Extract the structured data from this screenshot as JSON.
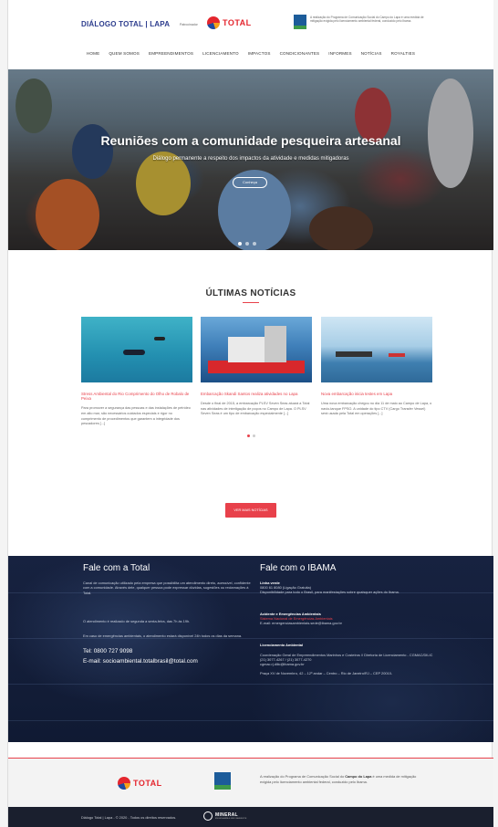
{
  "header": {
    "site_title": "DIÁLOGO TOTAL | LAPA",
    "patrocinio": "Patrocinador",
    "total_logo_text": "TOTAL",
    "ibama_note": "A realização do Programa de Comunicação Social do Campo do Lapa é uma medida de mitigação exigida pelo licenciamento ambiental federal, conduzido pelo Ibama."
  },
  "nav": [
    "HOME",
    "QUEM SOMOS",
    "EMPREENDIMENTOS",
    "LICENCIAMENTO",
    "IMPACTOS",
    "CONDICIONANTES",
    "INFORMES",
    "NOTÍCIAS",
    "ROYALTIES"
  ],
  "hero": {
    "title": "Reuniões com a comunidade pesqueira artesanal",
    "subtitle": "Diálogo permanente a respeito dos impactos da atividade e medidas mitigadoras",
    "button": "Conheça"
  },
  "news": {
    "section_title": "ÚLTIMAS NOTÍCIAS",
    "cards": [
      {
        "title": "Stress Ambiental do Rio Comprimento do Olho de Robalo de Peixa",
        "body": "Para promover a segurança das pessoas e das instalações de petróleo em alto mar, são necessários cuidados especiais e rígor no cumprimento de procedimentos que garantem a integridade dos pescadores [...]"
      },
      {
        "title": "Embarcação Skandi Santos realiza atividades no Lapa",
        "body": "Desde o final de 2015, a embarcação PLSV Seven Seas atuará a Total nas atividades de interligação de poços no Campo de Lapa. O PLSV Seven Seas é um tipo de embarcação especialmente [...]"
      },
      {
        "title": "Nova embarcação inicia testes em Lapa",
        "body": "Uma nova embarcação chegou no dia 11 de maio ao Campo de Lapa, o navio-tanque FPSO. A unidade do tipo CTV (Cargo Transfer Vessel) será usada pela Total em operações [...]"
      }
    ],
    "more_button": "VER MAIS NOTÍCIAS"
  },
  "contact_total": {
    "heading": "Fale com a Total",
    "intro": "Canal de comunicação utilizado pela empresa que possibilita um atendimento direto, acessível, confidente com a comunidade. Através dele, qualquer pessoa pode expressar dúvidas, sugestões ou reclamações à Total.",
    "hours": "O atendimento é realizado de segunda a sexta-feira, das 7h às 19h.",
    "emergency": "Em caso de emergências ambientais, o atendimento estará disponível 24h todos os dias da semana.",
    "phone": "Tel: 0800 727 9098",
    "email": "E-mail: socioambiental.totalbrasil@total.com"
  },
  "contact_ibama": {
    "heading": "Fale com o IBAMA",
    "linha_label": "Linha verde",
    "linha_phone": "0800 61 8080 (Ligação Gratuita)",
    "linha_desc": "Disponibilidade para todo o Brasil, para manifestações sobre quaisquer ações do Ibama.",
    "acidentes_label": "Acidente e Emergências Ambientais",
    "acidentes_system": "Sistema Nacional de Emergências Ambientais",
    "acidentes_email": "E-mail: emergenciasambientais.sede@ibama.gov.br",
    "lic_label": "Licenciamento Ambiental",
    "lic_desc": "Coordenação Geral de Empreendimentos Marinhos e Costeiros // Diretoria de Licenciamento - CGMAC/DILIC",
    "lic_phone": "(21) 3077-4267 / (21) 3077-4270",
    "lic_email": "cgmac.rj.dilic@ibama.gov.br",
    "address": "Praça XV de Novembro, 42 – 12º andar – Centro – Rio de Janeiro/RJ – CEP 20010-"
  },
  "sponsor": {
    "total_text": "TOTAL",
    "note_pre": "A realização do Programa de Comunicação Social do ",
    "note_bold": "Campo do Lapa",
    "note_post": " é uma medida de mitigação exigida pelo licenciamento ambiental federal, conduzido pelo Ibama."
  },
  "footer": {
    "copyright": "Diálogo Total | Lapa - © 2020 - Todos os direitos reservados.",
    "mineral": "MINERAL",
    "mineral_sub": "ENGENHARIA E MEIO AMBIENTE"
  },
  "colors": {
    "accent": "#e8414b",
    "brand_blue": "#2d3d8e",
    "footer_bg": "#1a1f2e"
  }
}
